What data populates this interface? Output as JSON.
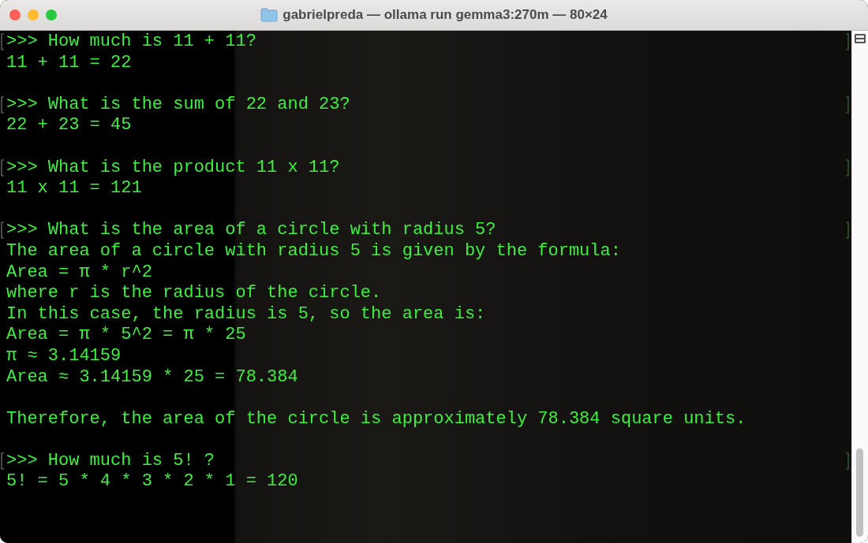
{
  "window": {
    "title": "gabrielpreda — ollama run gemma3:270m — 80×24"
  },
  "lines": [
    {
      "kind": "prompt",
      "text": ">>> How much is 11 + 11?"
    },
    {
      "kind": "output",
      "text": "11 + 11 = 22"
    },
    {
      "kind": "blank"
    },
    {
      "kind": "prompt",
      "text": ">>> What is the sum of 22 and 23?"
    },
    {
      "kind": "output",
      "text": "22 + 23 = 45"
    },
    {
      "kind": "blank"
    },
    {
      "kind": "prompt",
      "text": ">>> What is the product 11 x 11?"
    },
    {
      "kind": "output",
      "text": "11 x 11 = 121"
    },
    {
      "kind": "blank"
    },
    {
      "kind": "prompt",
      "text": ">>> What is the area of a circle with radius 5?"
    },
    {
      "kind": "output",
      "text": "The area of a circle with radius 5 is given by the formula:"
    },
    {
      "kind": "output",
      "text": "Area = π * r^2"
    },
    {
      "kind": "output",
      "text": "where r is the radius of the circle."
    },
    {
      "kind": "output",
      "text": "In this case, the radius is 5, so the area is:"
    },
    {
      "kind": "output",
      "text": "Area = π * 5^2 = π * 25"
    },
    {
      "kind": "output",
      "text": "π ≈ 3.14159"
    },
    {
      "kind": "output",
      "text": "Area ≈ 3.14159 * 25 = 78.384"
    },
    {
      "kind": "blank"
    },
    {
      "kind": "output",
      "text": "Therefore, the area of the circle is approximately 78.384 square units."
    },
    {
      "kind": "blank"
    },
    {
      "kind": "prompt",
      "text": ">>> How much is 5! ?"
    },
    {
      "kind": "output",
      "text": "5! = 5 * 4 * 3 * 2 * 1 = 120"
    }
  ]
}
